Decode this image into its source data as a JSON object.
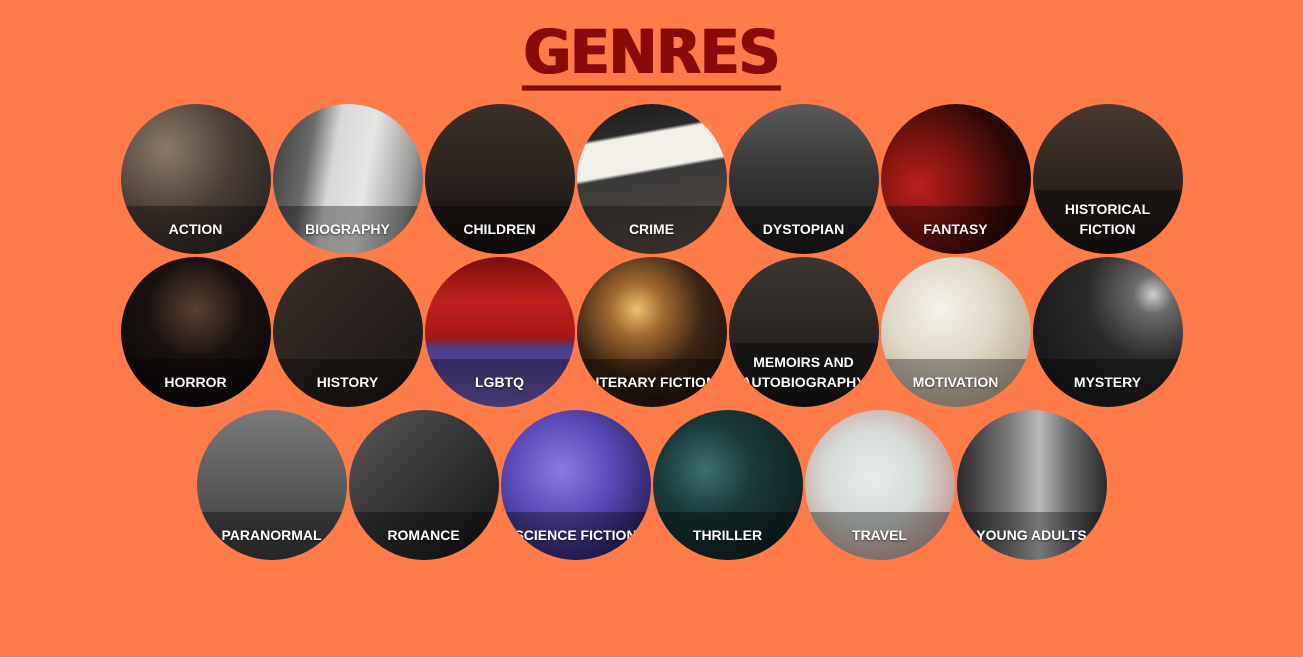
{
  "page": {
    "title": "GENRES"
  },
  "colors": {
    "background": "#ff7b4a",
    "title": "#8a0a0a",
    "label": "#ffffff"
  },
  "genres": [
    {
      "label": "ACTION"
    },
    {
      "label": "BIOGRAPHY"
    },
    {
      "label": "CHILDREN"
    },
    {
      "label": "CRIME"
    },
    {
      "label": "DYSTOPIAN"
    },
    {
      "label": "FANTASY"
    },
    {
      "label": "HISTORICAL\nFICTION"
    },
    {
      "label": "HORROR"
    },
    {
      "label": "HISTORY"
    },
    {
      "label": "LGBTQ"
    },
    {
      "label": "LITERARY FICTION"
    },
    {
      "label": "MEMOIRS AND\nAUTOBIOGRAPHY"
    },
    {
      "label": "MOTIVATION"
    },
    {
      "label": "MYSTERY"
    },
    {
      "label": "PARANORMAL"
    },
    {
      "label": "ROMANCE"
    },
    {
      "label": "SCIENCE FICTION"
    },
    {
      "label": "THRILLER"
    },
    {
      "label": "TRAVEL"
    },
    {
      "label": "YOUNG ADULTS"
    }
  ]
}
